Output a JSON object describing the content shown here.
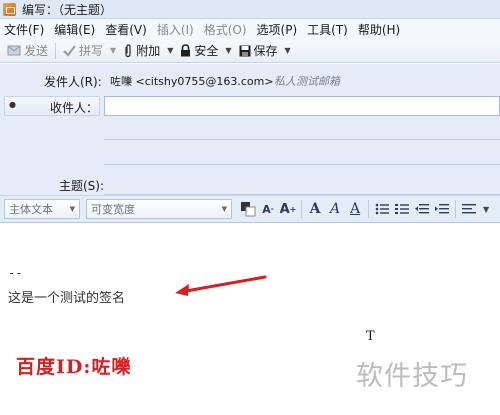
{
  "window": {
    "title": "编写：（无主题）"
  },
  "menu": [
    "文件(F)",
    "编辑(E)",
    "查看(V)",
    "插入(I)",
    "格式(O)",
    "选项(P)",
    "工具(T)",
    "帮助(H)"
  ],
  "menu_disabled": [
    false,
    false,
    false,
    true,
    true,
    false,
    false,
    false
  ],
  "toolbar": {
    "send": "发送",
    "spell": "拼写",
    "attach": "附加",
    "security": "安全",
    "save": "保存"
  },
  "header": {
    "from_label": "发件人(R):",
    "from_value": "咗嚛 <citshy0755@163.com>",
    "from_note": "私人测试邮箱",
    "to_label": "收件人：",
    "subject_label": "主题(S):"
  },
  "format": {
    "paragraph_style": "主体文本",
    "font": "可变宽度"
  },
  "body": {
    "sig_separator": "--",
    "signature": "这是一个测试的签名",
    "cursor_glyph": "T"
  },
  "watermarks": {
    "baidu_id": "百度ID:咗嚛",
    "site": "软件技巧"
  },
  "colors": {
    "accent_red": "#d81e1e",
    "header_bg": "#e4ecf7"
  }
}
